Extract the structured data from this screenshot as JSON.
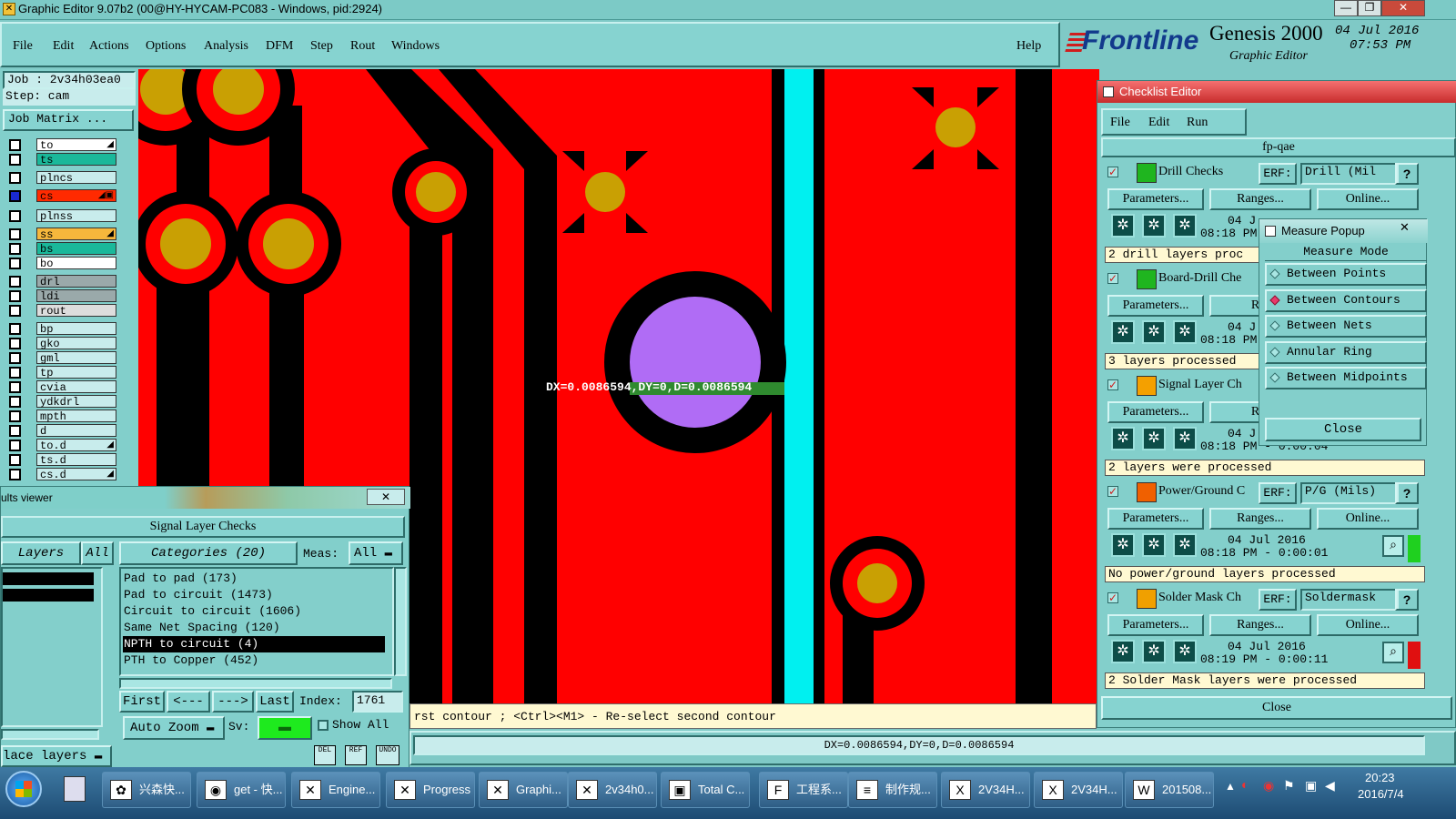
{
  "window": {
    "title": "Graphic Editor 9.07b2 (00@HY-HYCAM-PC083 - Windows, pid:2924)",
    "min": "—",
    "max": "❐",
    "close": "✕"
  },
  "menu": [
    "File",
    "Edit",
    "Actions",
    "Options",
    "Analysis",
    "DFM",
    "Step",
    "Rout",
    "Windows"
  ],
  "help": "Help",
  "brand": {
    "logo": "Frontline",
    "product": "Genesis 2000",
    "subtitle": "Graphic Editor",
    "date": "04 Jul 2016",
    "time": "07:53 PM"
  },
  "job": {
    "job": "Job : 2v34h03ea0",
    "step": "Step: cam",
    "matrix": "Job Matrix ..."
  },
  "layers": [
    {
      "name": "to",
      "color": "#ffffff",
      "mark": "◢"
    },
    {
      "name": "ts",
      "color": "#1ab89a",
      "mark": ""
    },
    {
      "name": "plncs",
      "color": "#c8ecec",
      "mark": ""
    },
    {
      "name": "cs",
      "color": "#ff2a00",
      "mark": "◢▣"
    },
    {
      "name": "plnss",
      "color": "#c8ecec",
      "mark": ""
    },
    {
      "name": "ss",
      "color": "#f6b73c",
      "mark": "◢"
    },
    {
      "name": "bs",
      "color": "#1ab89a",
      "mark": ""
    },
    {
      "name": "bo",
      "color": "#ffffff",
      "mark": ""
    },
    {
      "name": "drl",
      "color": "#9aa9aa",
      "mark": ""
    },
    {
      "name": "ldi",
      "color": "#9aa9aa",
      "mark": ""
    },
    {
      "name": "rout",
      "color": "#dddddd",
      "mark": ""
    },
    {
      "name": "bp",
      "color": "#c8ecec",
      "mark": ""
    },
    {
      "name": "gko",
      "color": "#c8ecec",
      "mark": ""
    },
    {
      "name": "gml",
      "color": "#c8ecec",
      "mark": ""
    },
    {
      "name": "tp",
      "color": "#c8ecec",
      "mark": ""
    },
    {
      "name": "cvia",
      "color": "#c8ecec",
      "mark": ""
    },
    {
      "name": "ydkdrl",
      "color": "#c8ecec",
      "mark": ""
    },
    {
      "name": "mpth",
      "color": "#c8ecec",
      "mark": ""
    },
    {
      "name": "d",
      "color": "#c8ecec",
      "mark": ""
    },
    {
      "name": "to.d",
      "color": "#c8ecec",
      "mark": "◢"
    },
    {
      "name": "ts.d",
      "color": "#c8ecec",
      "mark": ""
    },
    {
      "name": "cs.d",
      "color": "#c8ecec",
      "mark": "◢"
    }
  ],
  "measure_label": "DX=0.0086594,DY=0,D=0.0086594",
  "prompt_text": "rst contour ; <Ctrl><M1> - Re-select second contour",
  "status_text": "DX=0.0086594,DY=0,D=0.0086594",
  "results": {
    "title": "ults viewer",
    "close": "✕",
    "header": "Signal Layer Checks",
    "layers_btn": "Layers",
    "all_btn": "All",
    "categories_btn": "Categories (20)",
    "meas_label": "Meas:",
    "meas_value": "All",
    "items": [
      "Pad to pad (173)",
      "Pad to circuit (1473)",
      "Circuit to circuit (1606)",
      "Same Net Spacing (120)",
      "NPTH to circuit (4)",
      "PTH to Copper (452)"
    ],
    "first": "First",
    "prev": "<---",
    "next": "--->",
    "last": "Last",
    "index_label": "Index:",
    "index_value": "1761",
    "zoom": "Auto Zoom",
    "sv": "Sv:",
    "show_all": "Show All",
    "place_layers": "lace layers",
    "del": "DEL",
    "ref": "REF",
    "undo": "UNDO"
  },
  "checklist": {
    "title": "Checklist Editor",
    "menu": [
      "File",
      "Edit",
      "Run"
    ],
    "name": "fp-qae",
    "close": "Close",
    "checks": [
      {
        "title": "Drill Checks",
        "erf_label": "ERF:",
        "erf": "Drill (Mil",
        "help": "?",
        "params": "Parameters...",
        "ranges": "Ranges...",
        "online": "Online...",
        "date": "04 J",
        "time": "08:18 PM",
        "msg": "2 drill layers proc"
      },
      {
        "title": "Board-Drill Che",
        "erf_label": "",
        "erf": "",
        "help": "",
        "params": "Parameters...",
        "ranges": "Rar",
        "online": "",
        "date": "04 J",
        "time": "08:18 PM",
        "msg": "3 layers processed"
      },
      {
        "title": "Signal Layer Ch",
        "erf_label": "",
        "erf": "",
        "help": "",
        "params": "Parameters...",
        "ranges": "Rar",
        "online": "",
        "date": "04 J",
        "time": "08:18 PM - 0:00:04",
        "msg": "2 layers were processed"
      },
      {
        "title": "Power/Ground C",
        "erf_label": "ERF:",
        "erf": "P/G (Mils)",
        "help": "?",
        "params": "Parameters...",
        "ranges": "Ranges...",
        "online": "Online...",
        "date": "04 Jul 2016",
        "time": "08:18 PM - 0:00:01",
        "msg": "No power/ground layers processed"
      },
      {
        "title": "Solder Mask Ch",
        "erf_label": "ERF:",
        "erf": "Soldermask",
        "help": "?",
        "params": "Parameters...",
        "ranges": "Ranges...",
        "online": "Online...",
        "date": "04 Jul 2016",
        "time": "08:19 PM - 0:00:11",
        "msg": "2 Solder Mask layers were processed"
      }
    ]
  },
  "measure": {
    "title": "Measure Popup",
    "close_x": "✕",
    "header": "Measure Mode",
    "modes": [
      "Between Points",
      "Between Contours",
      "Between Nets",
      "Annular Ring",
      "Between Midpoints"
    ],
    "selected": 1,
    "close": "Close"
  },
  "taskbar": {
    "items": [
      {
        "label": "兴森快...",
        "icon": "✿"
      },
      {
        "label": "get - 快...",
        "icon": "◉"
      },
      {
        "label": "Engine...",
        "icon": "✕"
      },
      {
        "label": "Progress",
        "icon": "✕"
      },
      {
        "label": "Graphi...",
        "icon": "✕"
      },
      {
        "label": "2v34h0...",
        "icon": "✕"
      },
      {
        "label": "Total C...",
        "icon": "▣"
      },
      {
        "label": "工程系...",
        "icon": "F"
      },
      {
        "label": "制作规...",
        "icon": "≡"
      },
      {
        "label": "2V34H...",
        "icon": "X"
      },
      {
        "label": "2V34H...",
        "icon": "X"
      },
      {
        "label": "201508...",
        "icon": "W"
      }
    ],
    "time": "20:23",
    "date": "2016/7/4"
  },
  "colors": {
    "copper": "#ff0000",
    "pad": "#c9a003",
    "trace": "#000000",
    "cyan": "#00f0f0",
    "selected": "#b06cf5",
    "panel": "#83cfcb"
  }
}
